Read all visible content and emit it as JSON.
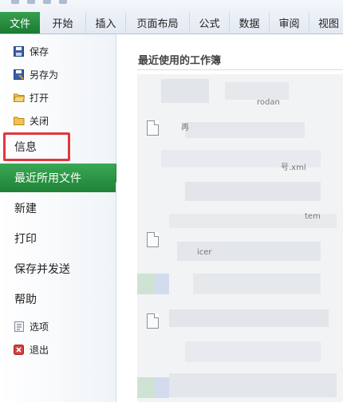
{
  "ribbon": {
    "tabs": [
      "文件",
      "开始",
      "插入",
      "页面布局",
      "公式",
      "数据",
      "审阅",
      "视图"
    ],
    "active_tab_color": "#1f8237"
  },
  "leftnav": {
    "save": {
      "label": "保存",
      "icon": "save-icon"
    },
    "save_as": {
      "label": "另存为",
      "icon": "save-as-icon"
    },
    "open": {
      "label": "打开",
      "icon": "open-folder-icon"
    },
    "close": {
      "label": "关闭",
      "icon": "close-folder-icon"
    },
    "info": {
      "label": "信息"
    },
    "recent": {
      "label": "最近所用文件"
    },
    "new": {
      "label": "新建"
    },
    "print": {
      "label": "打印"
    },
    "save_send": {
      "label": "保存并发送"
    },
    "help": {
      "label": "帮助"
    },
    "options": {
      "label": "选项",
      "icon": "options-icon"
    },
    "exit": {
      "label": "退出",
      "icon": "exit-icon"
    },
    "highlight_color": "#e0383d"
  },
  "main": {
    "title": "最近使用的工作簿",
    "fragments": [
      "rodan",
      "再",
      "号.xml",
      "tem",
      "icer"
    ]
  }
}
